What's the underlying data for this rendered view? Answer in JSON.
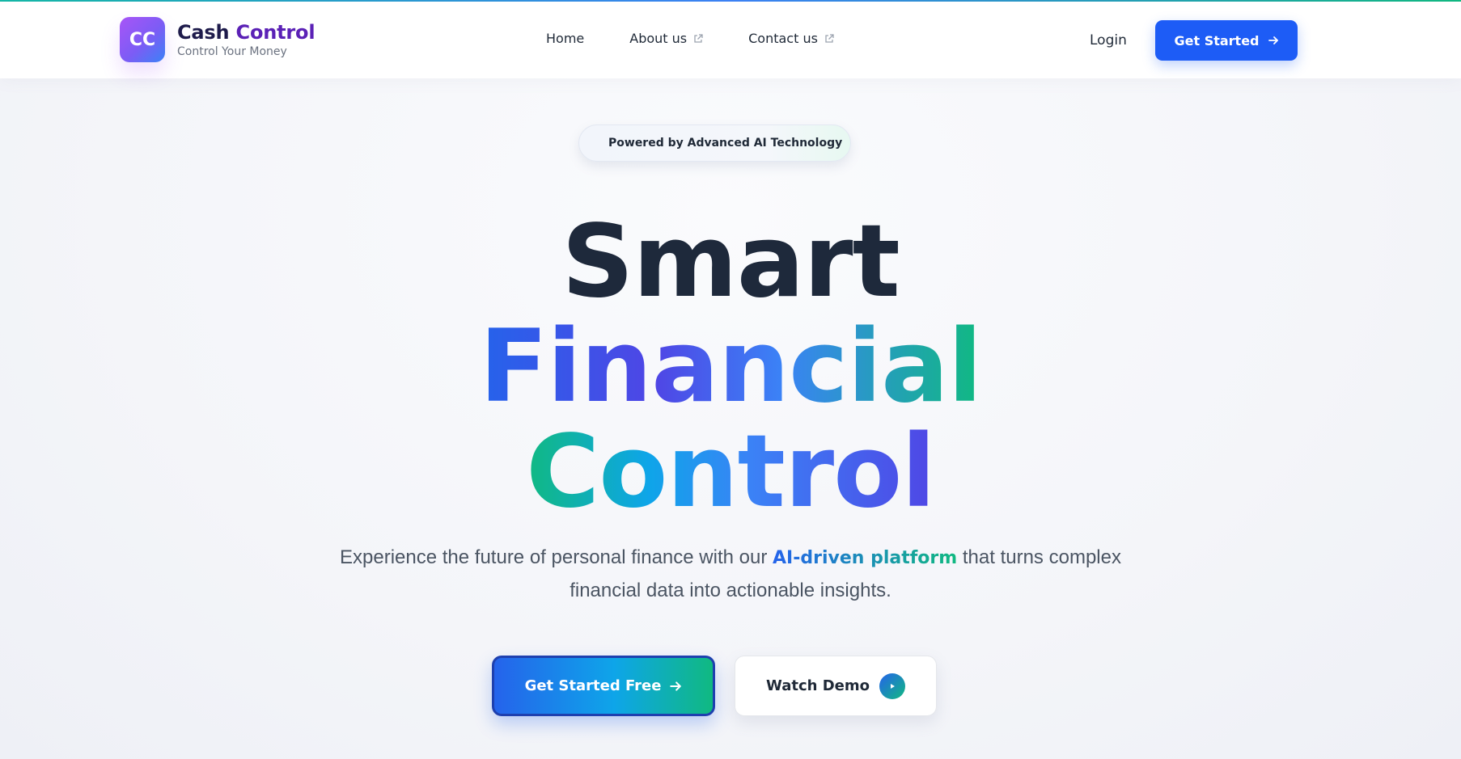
{
  "brand": {
    "logo_text": "CC",
    "name_part1": "Cash",
    "name_part2": "Control",
    "tagline": "Control Your Money"
  },
  "nav": {
    "items": [
      {
        "label": "Home",
        "external": false
      },
      {
        "label": "About us",
        "external": true
      },
      {
        "label": "Contact us",
        "external": true
      }
    ]
  },
  "header": {
    "login_label": "Login",
    "get_started_label": "Get Started"
  },
  "hero": {
    "badge_text": "Powered by Advanced AI Technology",
    "headline_line1": "Smart",
    "headline_line2": "Financial",
    "headline_line3": "Control",
    "sub_before": "Experience the future of personal finance with our",
    "sub_highlight": "AI-driven platform",
    "sub_after": "that turns complex financial data into actionable insights.",
    "cta_primary_label": "Get Started Free",
    "cta_secondary_label": "Watch Demo"
  },
  "colors": {
    "primary_blue": "#1d5cf6",
    "accent_green": "#10b981",
    "brand_purple": "#a855f7",
    "headline_dark": "#1e293b"
  },
  "icons": {
    "external": "external-link-icon",
    "arrow": "arrow-right-icon",
    "sparkle": "sparkle-icon",
    "play": "play-icon"
  }
}
